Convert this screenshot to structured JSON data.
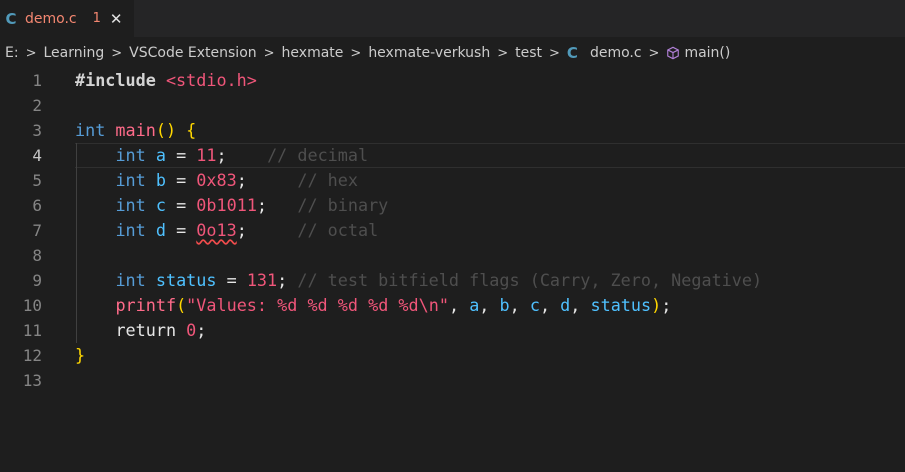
{
  "tab": {
    "icon": "C",
    "file_name": "demo.c",
    "problem_count": "1",
    "close_glyph": "✕"
  },
  "breadcrumb": {
    "items": [
      "E:",
      "Learning",
      "VSCode Extension",
      "hexmate",
      "hexmate-verkush",
      "test",
      "demo.c",
      "main()"
    ],
    "separator": ">"
  },
  "editor": {
    "line_numbers": [
      "1",
      "2",
      "3",
      "4",
      "5",
      "6",
      "7",
      "8",
      "9",
      "10",
      "11",
      "12",
      "13"
    ],
    "active_line": 4,
    "lines": [
      "#include <stdio.h>",
      "",
      "int main() {",
      "    int a = 11;    // decimal",
      "    int b = 0x83;     // hex",
      "    int c = 0b1011;   // binary",
      "    int d = 0o13;     // octal",
      "",
      "    int status = 131; // test bitfield flags (Carry, Zero, Negative)",
      "    printf(\"Values: %d %d %d %d %d\\n\", a, b, c, d, status);",
      "    return 0;",
      "}",
      ""
    ]
  },
  "colors": {
    "background": "#1e1e1e",
    "tab_error": "#f48771",
    "keyword": "#569cd6",
    "number": "#f0567a",
    "variable": "#4fc1ff",
    "comment": "#4e4e4e",
    "brace": "#ffd700"
  },
  "icons": {
    "tab_icon": "c-language-icon",
    "breadcrumb_file_icon": "c-language-icon",
    "breadcrumb_symbol_icon": "symbol-method-cube-icon"
  }
}
